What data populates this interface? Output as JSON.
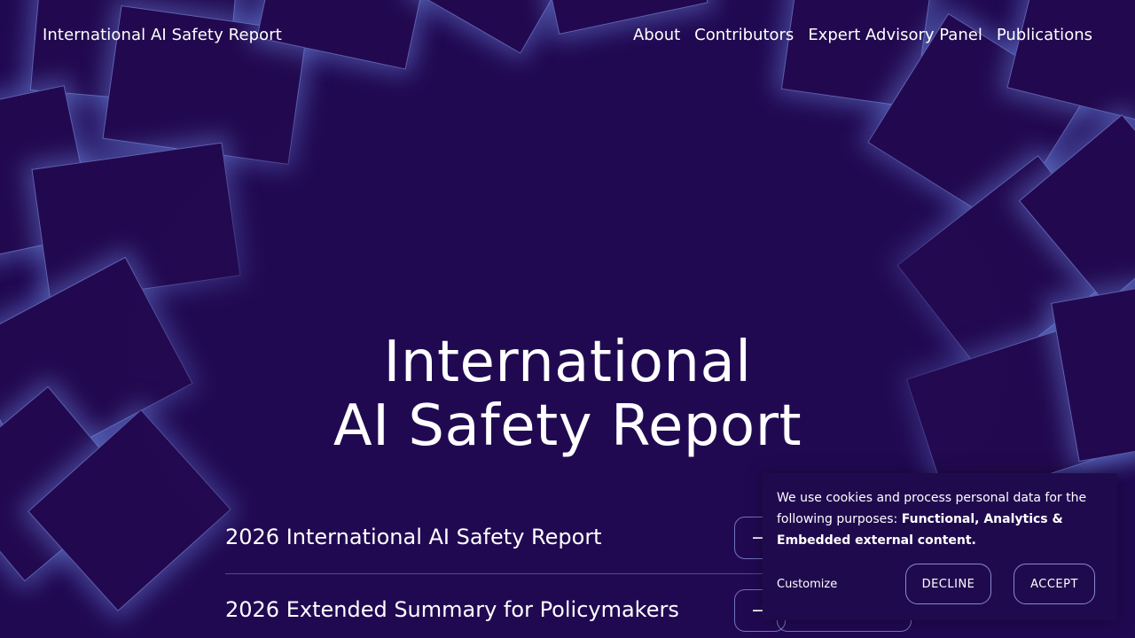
{
  "header": {
    "site_title": "International AI Safety Report",
    "nav": [
      {
        "label": "About"
      },
      {
        "label": "Contributors"
      },
      {
        "label": "Expert Advisory Panel"
      },
      {
        "label": "Publications"
      }
    ]
  },
  "hero": {
    "title_line1": "International",
    "title_line2": "AI Safety Report"
  },
  "publications": [
    {
      "label": "2026 International AI Safety Report",
      "icon": "arrow-right-icon"
    },
    {
      "label": "2026 Extended Summary for Policymakers",
      "icon": "arrow-right-icon"
    }
  ],
  "cookie_banner": {
    "text_intro": "We use cookies and process personal data for the following purposes: ",
    "text_purposes": "Functional, Analytics & Embedded external content",
    "text_end": ".",
    "customize_label": "Customize",
    "decline_label": "DECLINE",
    "accept_label": "ACCEPT"
  },
  "colors": {
    "background": "#210952",
    "tile_glow": "#6e8ce6",
    "text": "#ffffff"
  }
}
